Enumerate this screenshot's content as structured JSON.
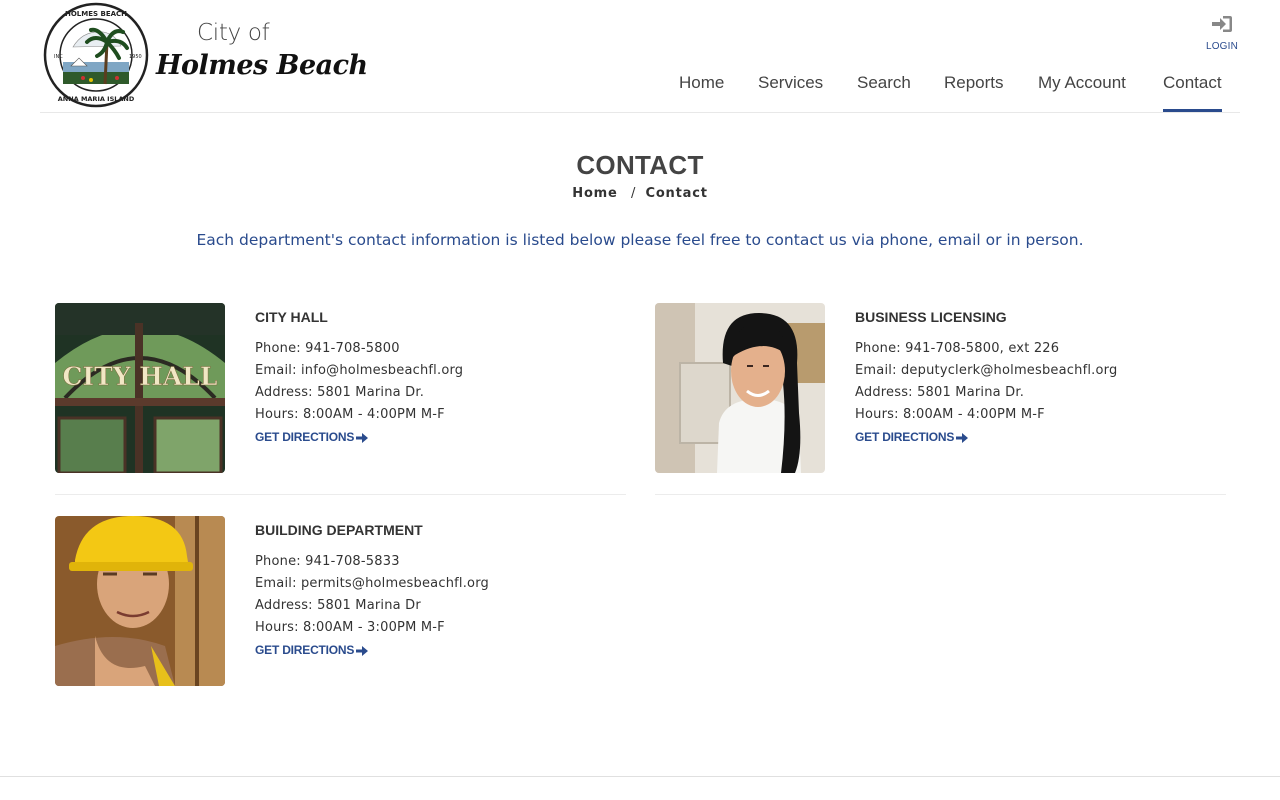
{
  "brand": {
    "city_of": "City of",
    "name": "Holmes Beach",
    "seal_label": "CITY OF HOLMES BEACH FLORIDA ANNA MARIA ISLAND INC 1950"
  },
  "header": {
    "login_label": "LOGIN",
    "nav": [
      "Home",
      "Services",
      "Search",
      "Reports",
      "My Account",
      "Contact"
    ],
    "active_nav": "Contact"
  },
  "page": {
    "title": "CONTACT",
    "breadcrumb": {
      "home": "Home",
      "separator": "/",
      "current": "Contact"
    },
    "intro": "Each department's contact information is listed below please feel free to contact us via phone, email or in person."
  },
  "departments": [
    {
      "title": "CITY HALL",
      "phone": "Phone: 941-708-5800",
      "email": "Email: info@holmesbeachfl.org",
      "address": "Address: 5801 Marina Dr.",
      "hours": "Hours: 8:00AM - 4:00PM M-F",
      "directions": "GET DIRECTIONS",
      "photo_caption": "CITY HALL"
    },
    {
      "title": "BUSINESS LICENSING",
      "phone": "Phone: 941-708-5800, ext 226",
      "email": "Email: deputyclerk@holmesbeachfl.org",
      "address": "Address: 5801 Marina Dr.",
      "hours": "Hours: 8:00AM - 4:00PM M-F",
      "directions": "GET DIRECTIONS"
    },
    {
      "title": "BUILDING DEPARTMENT",
      "phone": "Phone: 941-708-5833",
      "email": "Email: permits@holmesbeachfl.org",
      "address": "Address: 5801 Marina Dr",
      "hours": "Hours: 8:00AM - 3:00PM M-F",
      "directions": "GET DIRECTIONS"
    }
  ],
  "colors": {
    "accent": "#2a4b8d",
    "text": "#333333",
    "divider": "#ececec"
  }
}
